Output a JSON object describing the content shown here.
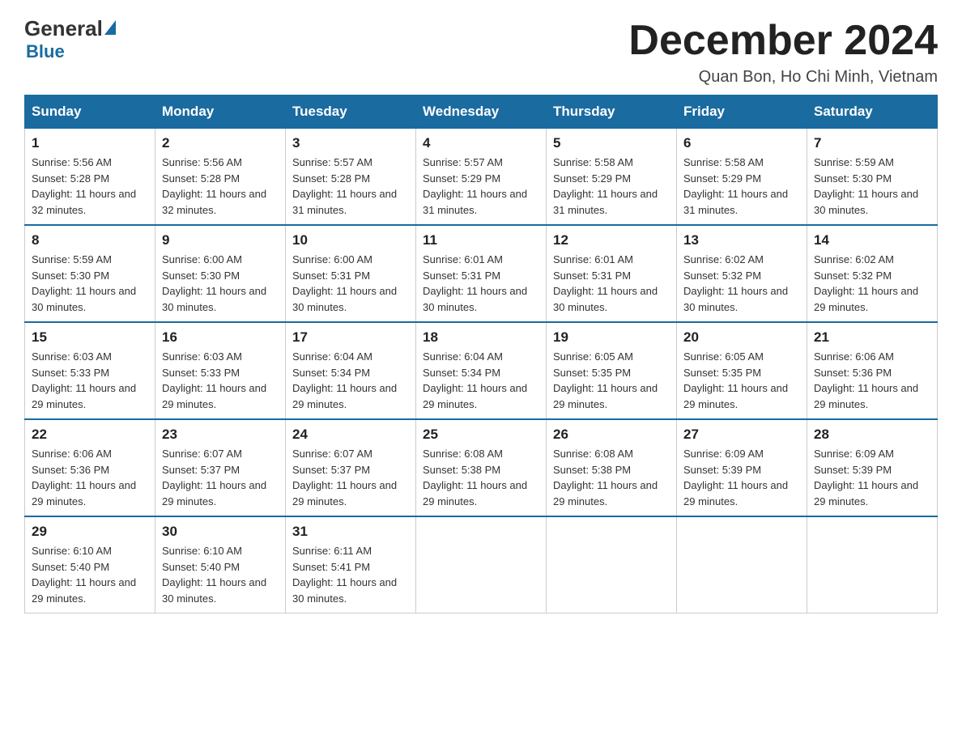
{
  "header": {
    "logo_general": "General",
    "logo_blue": "Blue",
    "title": "December 2024",
    "subtitle": "Quan Bon, Ho Chi Minh, Vietnam"
  },
  "days_of_week": [
    "Sunday",
    "Monday",
    "Tuesday",
    "Wednesday",
    "Thursday",
    "Friday",
    "Saturday"
  ],
  "weeks": [
    [
      {
        "day": 1,
        "sunrise": "5:56 AM",
        "sunset": "5:28 PM",
        "daylight": "11 hours and 32 minutes."
      },
      {
        "day": 2,
        "sunrise": "5:56 AM",
        "sunset": "5:28 PM",
        "daylight": "11 hours and 32 minutes."
      },
      {
        "day": 3,
        "sunrise": "5:57 AM",
        "sunset": "5:28 PM",
        "daylight": "11 hours and 31 minutes."
      },
      {
        "day": 4,
        "sunrise": "5:57 AM",
        "sunset": "5:29 PM",
        "daylight": "11 hours and 31 minutes."
      },
      {
        "day": 5,
        "sunrise": "5:58 AM",
        "sunset": "5:29 PM",
        "daylight": "11 hours and 31 minutes."
      },
      {
        "day": 6,
        "sunrise": "5:58 AM",
        "sunset": "5:29 PM",
        "daylight": "11 hours and 31 minutes."
      },
      {
        "day": 7,
        "sunrise": "5:59 AM",
        "sunset": "5:30 PM",
        "daylight": "11 hours and 30 minutes."
      }
    ],
    [
      {
        "day": 8,
        "sunrise": "5:59 AM",
        "sunset": "5:30 PM",
        "daylight": "11 hours and 30 minutes."
      },
      {
        "day": 9,
        "sunrise": "6:00 AM",
        "sunset": "5:30 PM",
        "daylight": "11 hours and 30 minutes."
      },
      {
        "day": 10,
        "sunrise": "6:00 AM",
        "sunset": "5:31 PM",
        "daylight": "11 hours and 30 minutes."
      },
      {
        "day": 11,
        "sunrise": "6:01 AM",
        "sunset": "5:31 PM",
        "daylight": "11 hours and 30 minutes."
      },
      {
        "day": 12,
        "sunrise": "6:01 AM",
        "sunset": "5:31 PM",
        "daylight": "11 hours and 30 minutes."
      },
      {
        "day": 13,
        "sunrise": "6:02 AM",
        "sunset": "5:32 PM",
        "daylight": "11 hours and 30 minutes."
      },
      {
        "day": 14,
        "sunrise": "6:02 AM",
        "sunset": "5:32 PM",
        "daylight": "11 hours and 29 minutes."
      }
    ],
    [
      {
        "day": 15,
        "sunrise": "6:03 AM",
        "sunset": "5:33 PM",
        "daylight": "11 hours and 29 minutes."
      },
      {
        "day": 16,
        "sunrise": "6:03 AM",
        "sunset": "5:33 PM",
        "daylight": "11 hours and 29 minutes."
      },
      {
        "day": 17,
        "sunrise": "6:04 AM",
        "sunset": "5:34 PM",
        "daylight": "11 hours and 29 minutes."
      },
      {
        "day": 18,
        "sunrise": "6:04 AM",
        "sunset": "5:34 PM",
        "daylight": "11 hours and 29 minutes."
      },
      {
        "day": 19,
        "sunrise": "6:05 AM",
        "sunset": "5:35 PM",
        "daylight": "11 hours and 29 minutes."
      },
      {
        "day": 20,
        "sunrise": "6:05 AM",
        "sunset": "5:35 PM",
        "daylight": "11 hours and 29 minutes."
      },
      {
        "day": 21,
        "sunrise": "6:06 AM",
        "sunset": "5:36 PM",
        "daylight": "11 hours and 29 minutes."
      }
    ],
    [
      {
        "day": 22,
        "sunrise": "6:06 AM",
        "sunset": "5:36 PM",
        "daylight": "11 hours and 29 minutes."
      },
      {
        "day": 23,
        "sunrise": "6:07 AM",
        "sunset": "5:37 PM",
        "daylight": "11 hours and 29 minutes."
      },
      {
        "day": 24,
        "sunrise": "6:07 AM",
        "sunset": "5:37 PM",
        "daylight": "11 hours and 29 minutes."
      },
      {
        "day": 25,
        "sunrise": "6:08 AM",
        "sunset": "5:38 PM",
        "daylight": "11 hours and 29 minutes."
      },
      {
        "day": 26,
        "sunrise": "6:08 AM",
        "sunset": "5:38 PM",
        "daylight": "11 hours and 29 minutes."
      },
      {
        "day": 27,
        "sunrise": "6:09 AM",
        "sunset": "5:39 PM",
        "daylight": "11 hours and 29 minutes."
      },
      {
        "day": 28,
        "sunrise": "6:09 AM",
        "sunset": "5:39 PM",
        "daylight": "11 hours and 29 minutes."
      }
    ],
    [
      {
        "day": 29,
        "sunrise": "6:10 AM",
        "sunset": "5:40 PM",
        "daylight": "11 hours and 29 minutes."
      },
      {
        "day": 30,
        "sunrise": "6:10 AM",
        "sunset": "5:40 PM",
        "daylight": "11 hours and 30 minutes."
      },
      {
        "day": 31,
        "sunrise": "6:11 AM",
        "sunset": "5:41 PM",
        "daylight": "11 hours and 30 minutes."
      },
      null,
      null,
      null,
      null
    ]
  ]
}
